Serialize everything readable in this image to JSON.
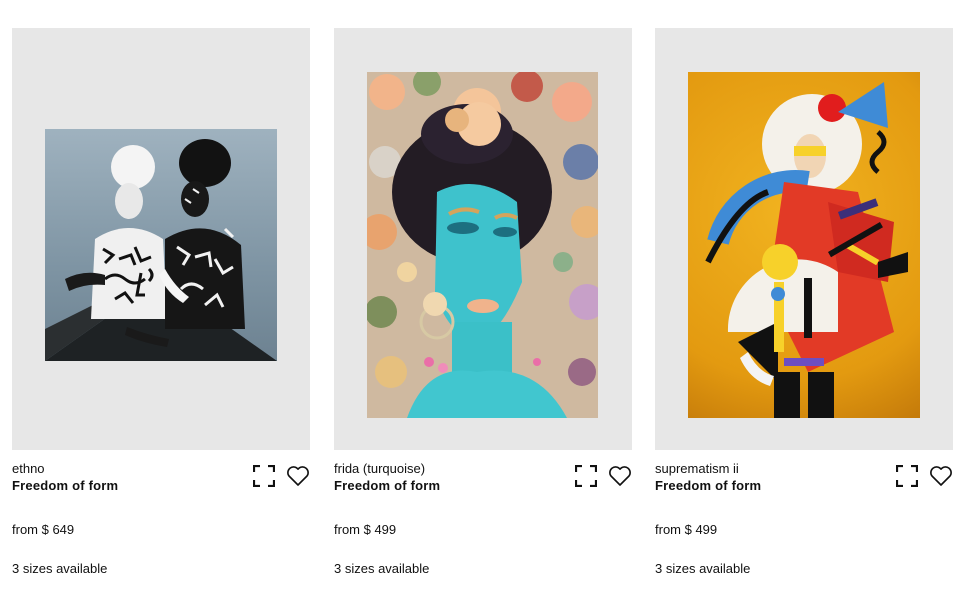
{
  "products": [
    {
      "name": "ethno",
      "collection": "Freedom of form",
      "price": "from $ 649",
      "sizes": "3 sizes available",
      "artwork": "ethno-portrait-image"
    },
    {
      "name": "frida (turquoise)",
      "collection": "Freedom of form",
      "price": "from $ 499",
      "sizes": "3 sizes available",
      "artwork": "frida-turquoise-portrait-image"
    },
    {
      "name": "suprematism ii",
      "collection": "Freedom of form",
      "price": "from $ 499",
      "sizes": "3 sizes available",
      "artwork": "suprematism-portrait-image"
    }
  ],
  "icons": {
    "expand": "expand-icon",
    "favorite": "heart-icon"
  },
  "colors": {
    "card_background": "#e7e7e7",
    "text": "#111111",
    "page_background": "#ffffff"
  }
}
